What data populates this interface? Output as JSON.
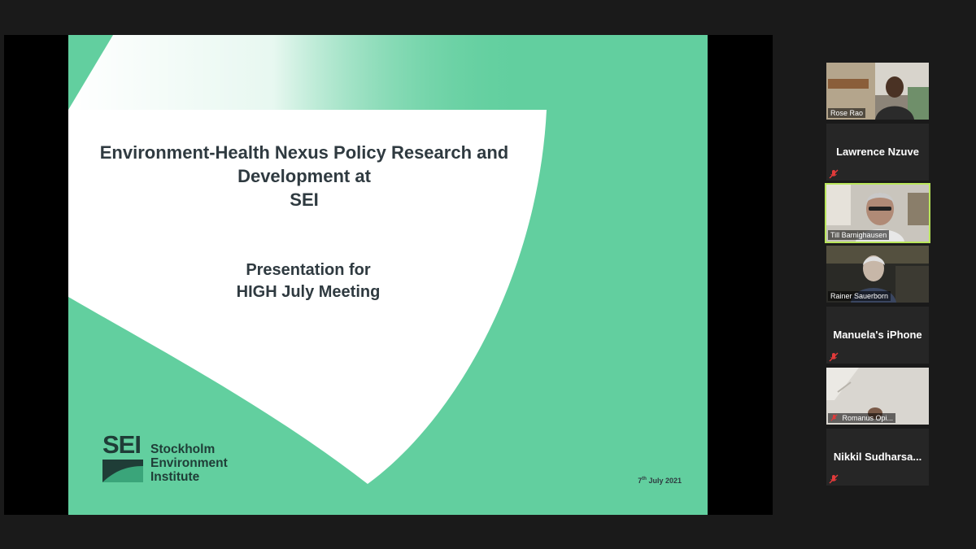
{
  "slide": {
    "title_line1": "Environment-Health Nexus Policy Research and",
    "title_line2": "Development at",
    "title_line3": "SEI",
    "subtitle_line1": "Presentation for",
    "subtitle_line2": "HIGH July Meeting",
    "logo_letters": "SEI",
    "logo_line1": "Stockholm",
    "logo_line2": "Environment",
    "logo_line3": "Institute",
    "date_day": "7",
    "date_suffix": "th",
    "date_rest": " July 2021"
  },
  "participants": [
    {
      "name": "Rose Rao",
      "video": true,
      "muted": false,
      "active": false
    },
    {
      "name": "Lawrence Nzuve",
      "video": false,
      "muted": true,
      "active": false
    },
    {
      "name": "Till Barnighausen",
      "video": true,
      "muted": false,
      "active": true
    },
    {
      "name": "Rainer Sauerborn",
      "video": true,
      "muted": false,
      "active": false
    },
    {
      "name": "Manuela's iPhone",
      "video": false,
      "muted": true,
      "active": false
    },
    {
      "name": "Romanus Opi...",
      "video": true,
      "muted": true,
      "active": false
    },
    {
      "name": "Nikkil  Sudharsa...",
      "video": false,
      "muted": true,
      "active": false
    }
  ],
  "colors": {
    "slide_green": "#62cf9f",
    "active_speaker": "#b9e55a",
    "muted_red": "#e23a3a"
  },
  "icons": {
    "muted": "mic-off-icon"
  }
}
